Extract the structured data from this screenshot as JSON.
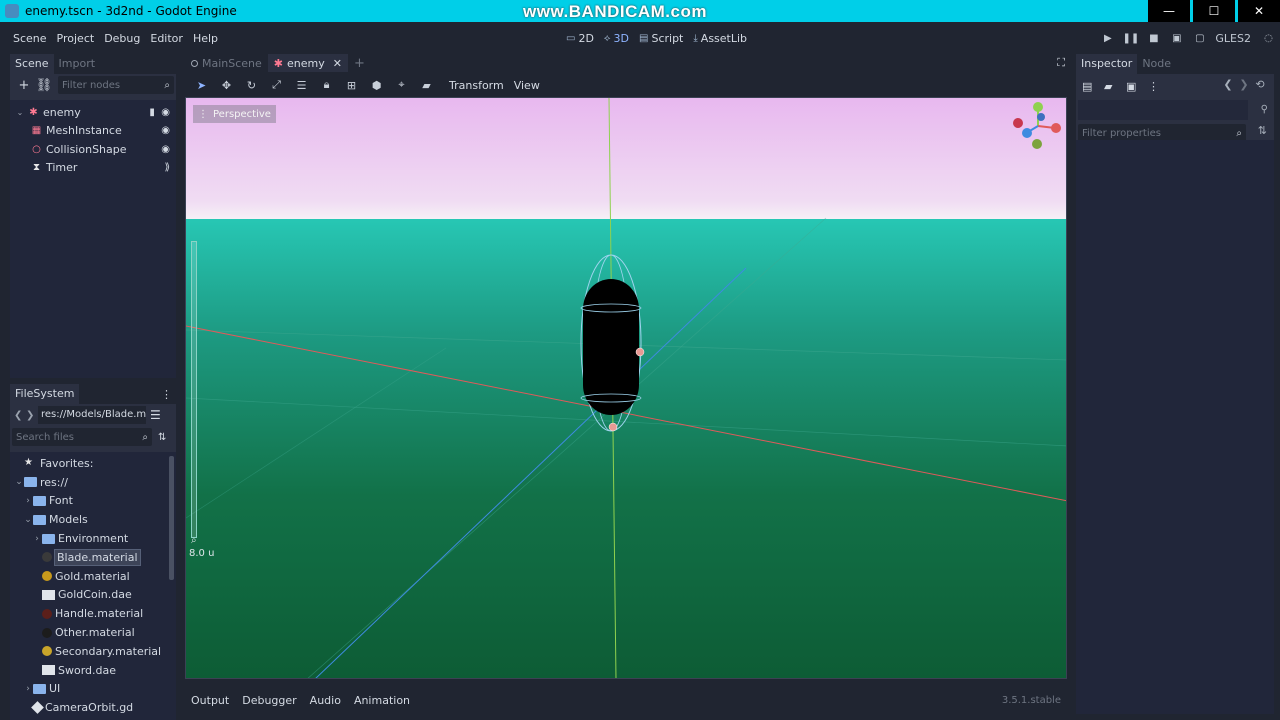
{
  "window": {
    "title": "enemy.tscn - 3d2nd - Godot Engine",
    "watermark": "www.BANDICAM.com",
    "controls": [
      "—",
      "☐",
      "✕"
    ]
  },
  "menubar": {
    "items": [
      "Scene",
      "Project",
      "Debug",
      "Editor",
      "Help"
    ],
    "modes": [
      {
        "icon": "2d-icon",
        "label": "2D"
      },
      {
        "icon": "3d-icon",
        "label": "3D"
      },
      {
        "icon": "script-icon",
        "label": "Script"
      },
      {
        "icon": "assetlib-icon",
        "label": "AssetLib"
      }
    ],
    "active_mode": "3D",
    "renderer": "GLES2"
  },
  "scene_dock": {
    "tabs": [
      "Scene",
      "Import"
    ],
    "filter_placeholder": "Filter nodes",
    "nodes": [
      {
        "name": "enemy",
        "icon": "kinematic-body-icon",
        "level": 0
      },
      {
        "name": "MeshInstance",
        "icon": "mesh-instance-icon",
        "level": 1
      },
      {
        "name": "CollisionShape",
        "icon": "collision-shape-icon",
        "level": 1
      },
      {
        "name": "Timer",
        "icon": "timer-icon",
        "level": 1
      }
    ]
  },
  "filesystem_dock": {
    "title": "FileSystem",
    "path": "res://Models/Blade.ma",
    "search_placeholder": "Search files",
    "items": [
      {
        "label": "Favorites:",
        "type": "favorites",
        "level": 0
      },
      {
        "label": "res://",
        "type": "folder",
        "level": 0,
        "expanded": true
      },
      {
        "label": "Font",
        "type": "folder",
        "level": 1,
        "expanded": false
      },
      {
        "label": "Models",
        "type": "folder",
        "level": 1,
        "expanded": true
      },
      {
        "label": "Environment",
        "type": "folder",
        "level": 2,
        "expanded": false
      },
      {
        "label": "Blade.material",
        "type": "material",
        "level": 2,
        "color": "#3a3a3a",
        "selected": true
      },
      {
        "label": "Gold.material",
        "type": "material",
        "level": 2,
        "color": "#c99a1c"
      },
      {
        "label": "GoldCoin.dae",
        "type": "dae",
        "level": 2
      },
      {
        "label": "Handle.material",
        "type": "material",
        "level": 2,
        "color": "#5b1f1a"
      },
      {
        "label": "Other.material",
        "type": "material",
        "level": 2,
        "color": "#1c1c1c"
      },
      {
        "label": "Secondary.material",
        "type": "material",
        "level": 2,
        "color": "#c9a52a"
      },
      {
        "label": "Sword.dae",
        "type": "dae",
        "level": 2
      },
      {
        "label": "UI",
        "type": "folder",
        "level": 1,
        "expanded": false
      },
      {
        "label": "CameraOrbit.gd",
        "type": "gd",
        "level": 1
      }
    ]
  },
  "editor": {
    "tabs": [
      {
        "label": "MainScene",
        "active": false
      },
      {
        "label": "enemy",
        "active": true
      }
    ],
    "toolbar_menus": [
      "Transform",
      "View"
    ],
    "viewport": {
      "perspective_label": "Perspective",
      "zoom_label": "8.0 u"
    }
  },
  "bottom_panel": {
    "tabs": [
      "Output",
      "Debugger",
      "Audio",
      "Animation"
    ],
    "version": "3.5.1.stable"
  },
  "inspector": {
    "tabs": [
      "Inspector",
      "Node"
    ],
    "filter_placeholder": "Filter properties"
  },
  "colors": {
    "accent": "#8eb4ff",
    "axis_x": "#e05a5a",
    "axis_y": "#8fd14f",
    "axis_z": "#3e8be0"
  }
}
